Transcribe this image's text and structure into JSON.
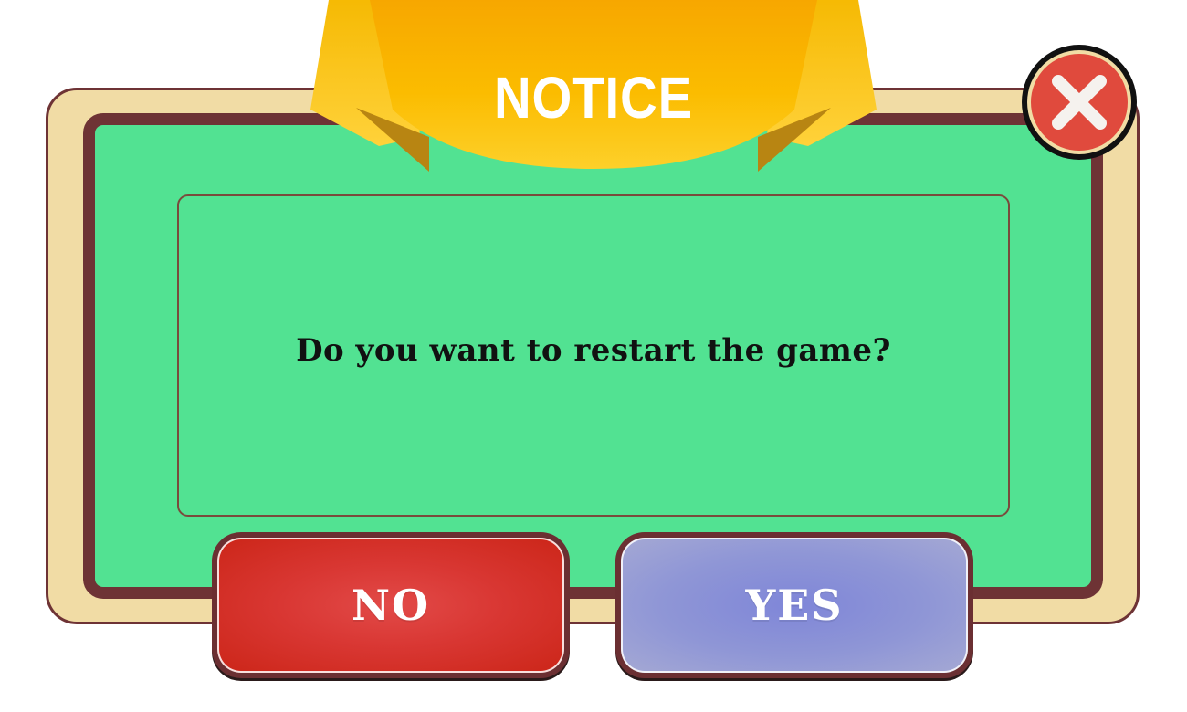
{
  "dialog": {
    "title": "NOTICE",
    "message": "Do you want to restart the game?",
    "no_label": "NO",
    "yes_label": "YES"
  },
  "icons": {
    "close": "close-x-icon",
    "banner": "ribbon-banner"
  },
  "colors": {
    "panel_green": "#52e292",
    "frame_cream": "#f1dca5",
    "frame_brown": "#6e3335",
    "ribbon_gold": "#fbb800",
    "close_red": "#e35242",
    "no_red": "#d93733",
    "yes_lavender": "#8f96d6"
  }
}
